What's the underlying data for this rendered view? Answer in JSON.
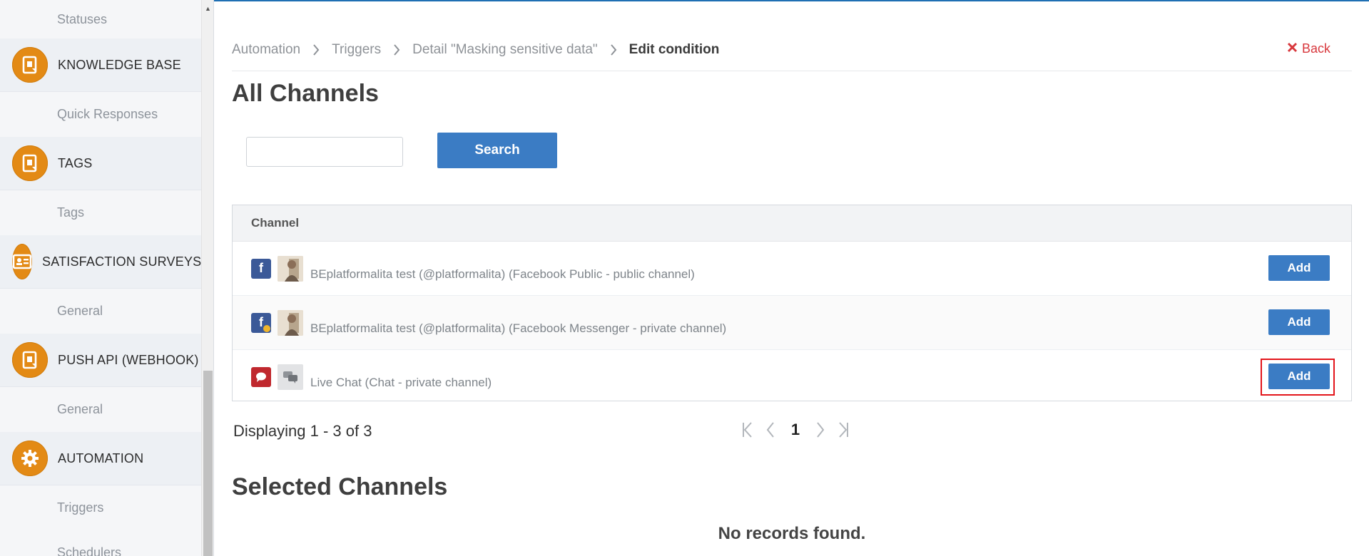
{
  "sidebar": {
    "items": [
      {
        "type": "item",
        "label": "Statuses"
      },
      {
        "type": "section",
        "label": "KNOWLEDGE BASE",
        "icon": "document-icon"
      },
      {
        "type": "item",
        "label": "Quick Responses"
      },
      {
        "type": "section",
        "label": "TAGS",
        "icon": "document-icon"
      },
      {
        "type": "item",
        "label": "Tags"
      },
      {
        "type": "section",
        "label": "SATISFACTION SURVEYS",
        "icon": "id-card-icon"
      },
      {
        "type": "item",
        "label": "General"
      },
      {
        "type": "section",
        "label": "PUSH API (WEBHOOK)",
        "icon": "document-icon"
      },
      {
        "type": "item",
        "label": "General"
      },
      {
        "type": "section",
        "label": "AUTOMATION",
        "icon": "gear-icon"
      },
      {
        "type": "item",
        "label": "Triggers"
      },
      {
        "type": "item",
        "label": "Schedulers"
      }
    ]
  },
  "breadcrumb": {
    "items": [
      "Automation",
      "Triggers",
      "Detail \"Masking sensitive data\"",
      "Edit condition"
    ]
  },
  "back_label": "Back",
  "all_channels_title": "All Channels",
  "search": {
    "value": "",
    "placeholder": "",
    "button_label": "Search"
  },
  "grid": {
    "column_header": "Channel",
    "rows": [
      {
        "icon": "facebook-icon",
        "name": "BEplatformalita test (@platformalita) (Facebook Public - public channel)",
        "button": "Add"
      },
      {
        "icon": "facebook-messenger-icon",
        "name": "BEplatformalita test (@platformalita) (Facebook Messenger - private channel)",
        "button": "Add"
      },
      {
        "icon": "chat-bubble-icon",
        "name": "Live Chat (Chat - private channel)",
        "button": "Add"
      }
    ]
  },
  "pagination": {
    "displaying": "Displaying 1 - 3 of 3",
    "current_page": "1"
  },
  "selected_channels_title": "Selected Channels",
  "no_records": "No records found.",
  "colors": {
    "accent": "#3b7cc4",
    "section_icon": "#e38a15",
    "back": "#d8383d",
    "highlight": "#e3151b"
  }
}
